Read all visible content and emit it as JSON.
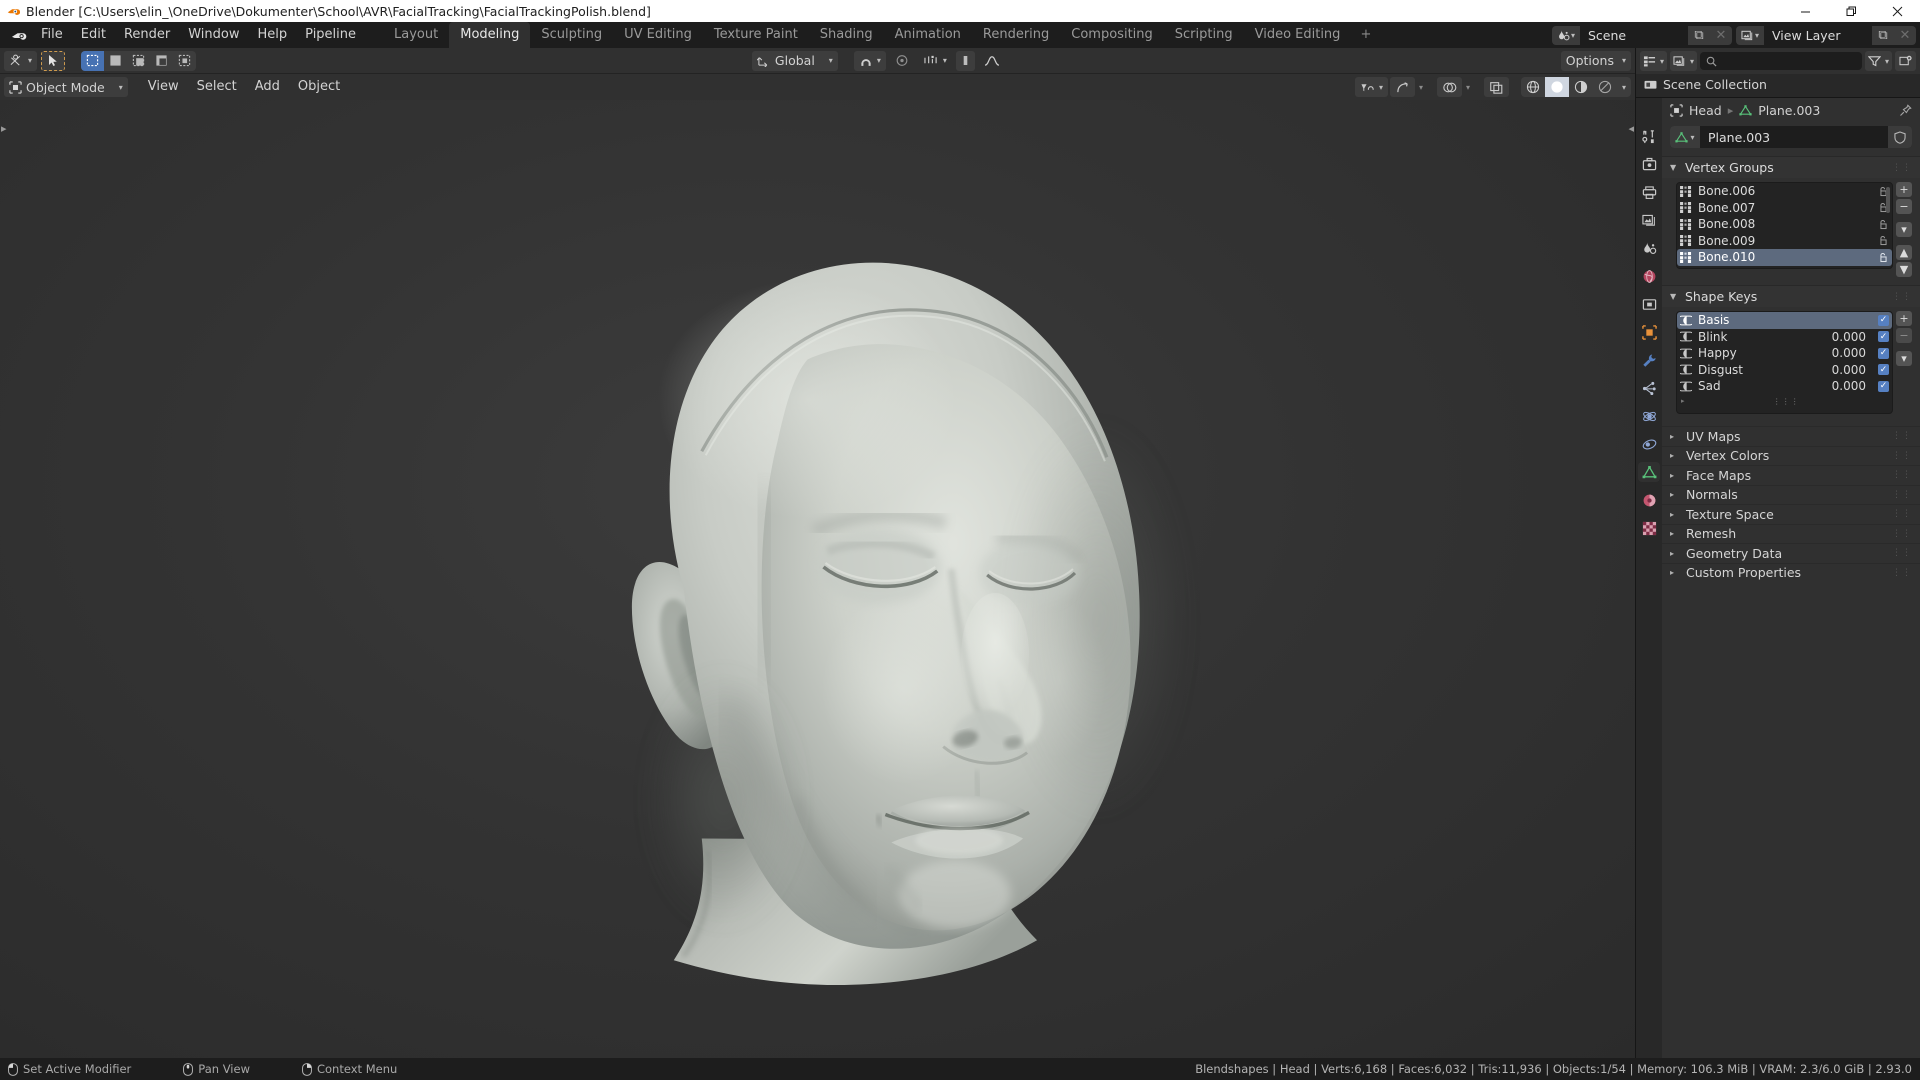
{
  "window": {
    "title": "Blender [C:\\Users\\elin_\\OneDrive\\Dokumenter\\School\\AVR\\FacialTracking\\FacialTrackingPolish.blend]",
    "minimize_label": "—",
    "maximize_label": "❐",
    "close_label": "✕"
  },
  "topbar": {
    "menus": [
      "File",
      "Edit",
      "Render",
      "Window",
      "Help",
      "Pipeline"
    ],
    "workspaces": [
      {
        "label": "Layout",
        "active": false
      },
      {
        "label": "Modeling",
        "active": true
      },
      {
        "label": "Sculpting",
        "active": false
      },
      {
        "label": "UV Editing",
        "active": false
      },
      {
        "label": "Texture Paint",
        "active": false
      },
      {
        "label": "Shading",
        "active": false
      },
      {
        "label": "Animation",
        "active": false
      },
      {
        "label": "Rendering",
        "active": false
      },
      {
        "label": "Compositing",
        "active": false
      },
      {
        "label": "Scripting",
        "active": false
      },
      {
        "label": "Video Editing",
        "active": false
      },
      {
        "label": "+",
        "active": false
      }
    ],
    "scene": {
      "name": "Scene",
      "new_label": "⧉",
      "unlink_label": "✕"
    },
    "view_layer": {
      "name": "View Layer",
      "new_label": "⧉",
      "unlink_label": "✕"
    }
  },
  "viewport": {
    "tool_header": {
      "transform_orientation": "Global",
      "options_label": "Options"
    },
    "header": {
      "mode": "Object Mode",
      "menus": [
        "View",
        "Select",
        "Add",
        "Object"
      ]
    },
    "object_name": "Head"
  },
  "outliner": {
    "search_placeholder": "",
    "root": "Scene Collection"
  },
  "properties": {
    "breadcrumb": [
      "Head",
      "Plane.003"
    ],
    "datablock_name": "Plane.003",
    "vertex_groups": {
      "title": "Vertex Groups",
      "items": [
        {
          "name": "Bone.006",
          "selected": false
        },
        {
          "name": "Bone.007",
          "selected": false
        },
        {
          "name": "Bone.008",
          "selected": false
        },
        {
          "name": "Bone.009",
          "selected": false
        },
        {
          "name": "Bone.010",
          "selected": true
        }
      ],
      "add_label": "+",
      "remove_label": "−"
    },
    "shape_keys": {
      "title": "Shape Keys",
      "items": [
        {
          "name": "Basis",
          "value": "",
          "enabled": true,
          "selected": true
        },
        {
          "name": "Blink",
          "value": "0.000",
          "enabled": true,
          "selected": false
        },
        {
          "name": "Happy",
          "value": "0.000",
          "enabled": true,
          "selected": false
        },
        {
          "name": "Disgust",
          "value": "0.000",
          "enabled": true,
          "selected": false
        },
        {
          "name": "Sad",
          "value": "0.000",
          "enabled": true,
          "selected": false
        }
      ],
      "add_label": "+",
      "remove_label": "−"
    },
    "collapsed_panels": [
      "UV Maps",
      "Vertex Colors",
      "Face Maps",
      "Normals",
      "Texture Space",
      "Remesh",
      "Geometry Data",
      "Custom Properties"
    ]
  },
  "statusbar": {
    "hints": [
      {
        "label": "Set Active Modifier",
        "button": "left"
      },
      {
        "label": "Pan View",
        "button": "middle"
      },
      {
        "label": "Context Menu",
        "button": "right"
      }
    ],
    "stats": "Blendshapes | Head | Verts:6,168 | Faces:6,032 | Tris:11,936 | Objects:1/54 | Memory: 106.3 MiB | VRAM: 2.3/6.0 GiB | 2.93.0"
  },
  "colors": {
    "accent_blue": "#4772b3",
    "select_orange": "#e8913a",
    "mesh_green": "#59c17a",
    "panel_bg": "#303030",
    "editor_bg": "#282828"
  }
}
